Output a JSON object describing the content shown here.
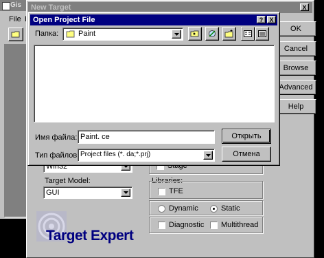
{
  "back_window": {
    "title_fragment": "Gis",
    "menu_file": "File",
    "menu_e": "E"
  },
  "new_target": {
    "title": "New Target",
    "close_glyph": "X",
    "help_glyph": "?",
    "buttons": {
      "ok": "OK",
      "cancel": "Cancel",
      "browse": "Browse",
      "advanced": "Advanced",
      "help": "Help"
    },
    "target_model_label": "Target Model:",
    "target_model_value": "GUI",
    "hidden_combo_value": "Win32",
    "stage_fragment": "Stage",
    "libraries_label": "Libraries:",
    "option_tfe": "TFE",
    "option_dynamic": "Dynamic",
    "option_static": "Static",
    "option_diagnostic": "Diagnostic",
    "option_multithread": "Multithread",
    "brand": "Target Expert"
  },
  "open_dialog": {
    "title": "Open Project File",
    "help_glyph": "?",
    "close_glyph": "X",
    "folder_label": "Папка:",
    "folder_value": "Paint",
    "filename_label": "Имя файла:",
    "filename_value": "Paint. ce",
    "filetype_label": "Тип файлов:",
    "filetype_value": "Project files (*. da;*.prj)",
    "open_button": "Открыть",
    "cancel_button": "Отмена"
  },
  "colors": {
    "title_active": "#000080",
    "title_inactive": "#808080",
    "face": "#c0c0c0",
    "brand_text": "#000080"
  }
}
